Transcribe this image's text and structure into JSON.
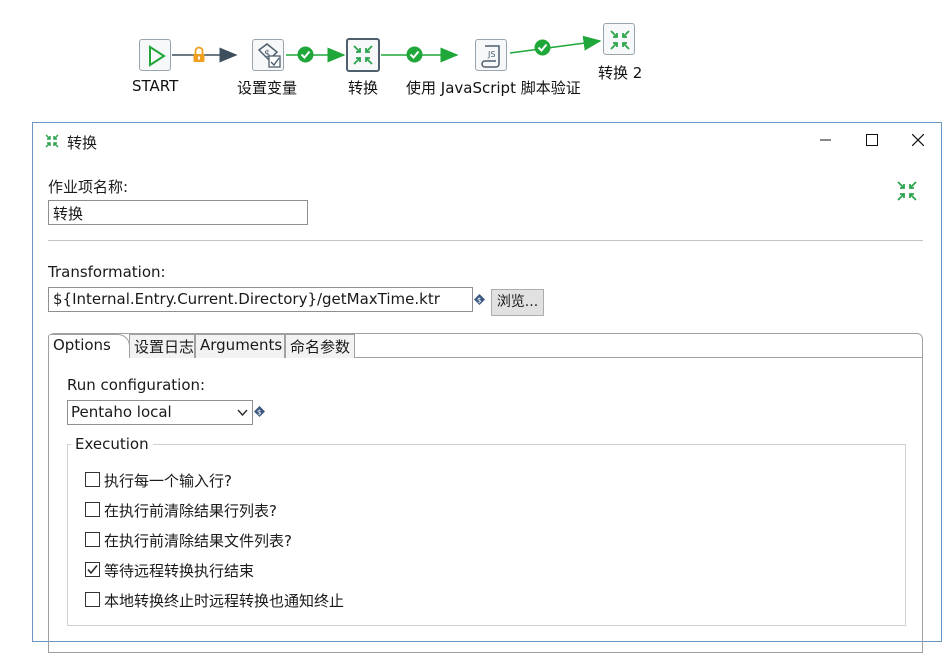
{
  "workflow": {
    "nodes": [
      {
        "label": "START",
        "icon": "start-icon"
      },
      {
        "label": "设置变量",
        "icon": "set-variables-icon"
      },
      {
        "label": "转换",
        "icon": "transformation-icon",
        "selected": true
      },
      {
        "label": "使用 JavaScript 脚本验证",
        "icon": "javascript-icon"
      },
      {
        "label": "转换 2",
        "icon": "transformation-icon"
      }
    ],
    "colors": {
      "hop_ok": "#1fa73a",
      "hop_default": "#3d4f5c",
      "lock": "#f0a01e",
      "icon_green": "#2da44e"
    }
  },
  "dialog": {
    "title": "转换",
    "job_entry_name_label": "作业项名称:",
    "job_entry_name_value": "转换",
    "transformation_label": "Transformation:",
    "transformation_value": "${Internal.Entry.Current.Directory}/getMaxTime.ktr",
    "browse_label": "浏览...",
    "tabs": [
      "Options",
      "设置日志",
      "Arguments",
      "命名参数"
    ],
    "active_tab": "Options",
    "run_configuration_label": "Run configuration:",
    "run_configuration_value": "Pentaho local",
    "execution_label": "Execution",
    "checkboxes": [
      {
        "label": "执行每一个输入行?",
        "checked": false
      },
      {
        "label": "在执行前清除结果行列表?",
        "checked": false
      },
      {
        "label": "在执行前清除结果文件列表?",
        "checked": false
      },
      {
        "label": "等待远程转换执行结束",
        "checked": true
      },
      {
        "label": "本地转换终止时远程转换也通知终止",
        "checked": false
      }
    ]
  }
}
